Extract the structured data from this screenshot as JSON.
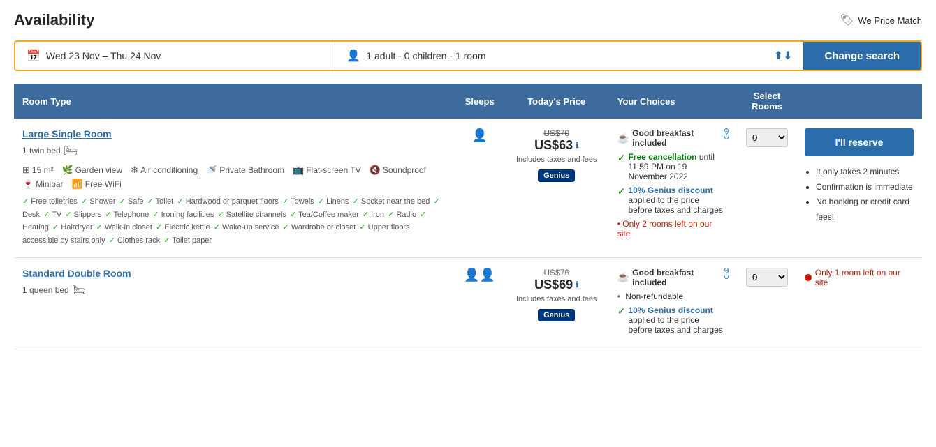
{
  "header": {
    "title": "Availability",
    "price_match_label": "We Price Match"
  },
  "search": {
    "date_range": "Wed 23 Nov – Thu 24 Nov",
    "guests": "1 adult · 0 children · 1 room",
    "change_btn": "Change search"
  },
  "table": {
    "columns": {
      "room_type": "Room Type",
      "sleeps": "Sleeps",
      "todays_price": "Today's Price",
      "your_choices": "Your Choices",
      "select_rooms": "Select Rooms"
    }
  },
  "sidebar": {
    "reserve_btn": "I'll reserve",
    "benefits": [
      "It only takes 2 minutes",
      "Confirmation is immediate",
      "No booking or credit card fees!"
    ]
  },
  "rooms": [
    {
      "name": "Large Single Room",
      "bed": "1 twin bed",
      "size": "15 m²",
      "amenities": [
        "Garden view",
        "Air conditioning",
        "Private Bathroom",
        "Flat-screen TV",
        "Soundproof",
        "Minibar",
        "Free WiFi"
      ],
      "features": [
        "Free toiletries",
        "Shower",
        "Safe",
        "Toilet",
        "Hardwood or parquet floors",
        "Towels",
        "Linens",
        "Socket near the bed",
        "Desk",
        "TV",
        "Slippers",
        "Telephone",
        "Ironing facilities",
        "Satellite channels",
        "Tea/Coffee maker",
        "Iron",
        "Radio",
        "Heating",
        "Hairdryer",
        "Walk-in closet",
        "Electric kettle",
        "Wake-up service",
        "Wardrobe or closet",
        "Upper floors accessible by stairs only",
        "Clothes rack",
        "Toilet paper"
      ],
      "sleeps": 1,
      "original_price": "US$70",
      "current_price": "US$63",
      "includes_text": "Includes taxes and fees",
      "genius": "Genius",
      "breakfast": "Good breakfast included",
      "free_cancel": "Free cancellation until 11:59 PM on 19 November 2022",
      "genius_discount": "10% Genius discount applied to the price before taxes and charges",
      "rooms_left": "Only 2 rooms left on our site",
      "non_refundable": null
    },
    {
      "name": "Standard Double Room",
      "bed": "1 queen bed",
      "size": null,
      "amenities": [],
      "features": [],
      "sleeps": 2,
      "original_price": "US$76",
      "current_price": "US$69",
      "includes_text": "Includes taxes and fees",
      "genius": "Genius",
      "breakfast": "Good breakfast included",
      "free_cancel": null,
      "genius_discount": "10% Genius discount applied to the price before taxes and charges",
      "rooms_left": "Only 1 room left on our site",
      "non_refundable": "Non-refundable"
    }
  ]
}
